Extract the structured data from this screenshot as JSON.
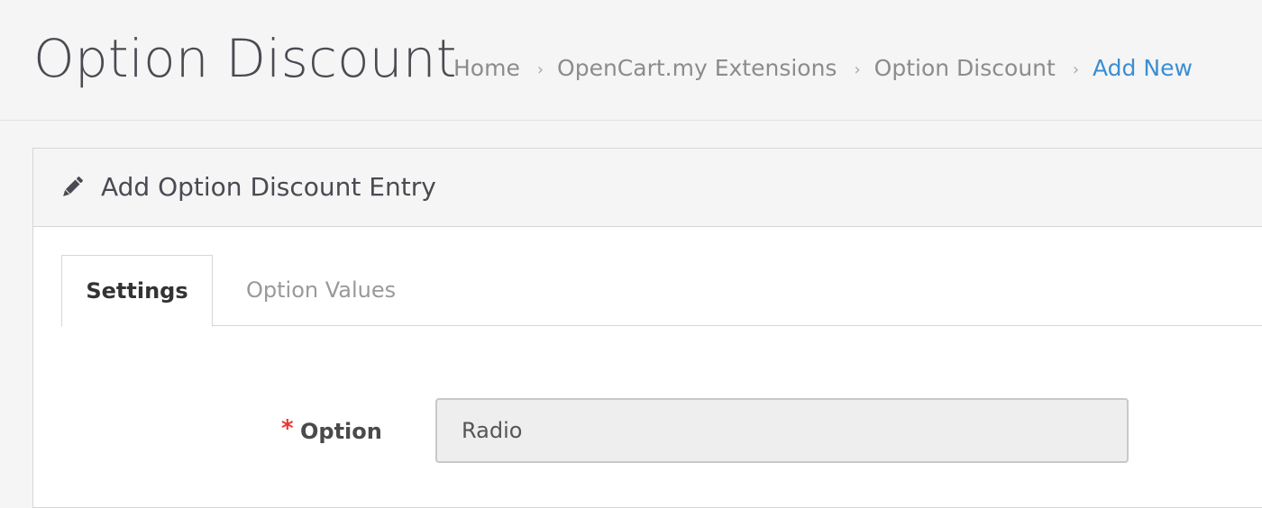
{
  "header": {
    "title": "Option Discount",
    "breadcrumbs": [
      {
        "label": "Home"
      },
      {
        "label": "OpenCart.my Extensions"
      },
      {
        "label": "Option Discount"
      },
      {
        "label": "Add New",
        "active": true
      }
    ],
    "separator": "›"
  },
  "panel": {
    "icon": "pencil-icon",
    "title": "Add Option Discount Entry"
  },
  "tabs": [
    {
      "label": "Settings",
      "active": true
    },
    {
      "label": "Option Values",
      "active": false
    }
  ],
  "form": {
    "option": {
      "required_mark": "*",
      "label": "Option",
      "value": "Radio"
    }
  },
  "colors": {
    "accent_link": "#3a8ed4",
    "required": "#e53935",
    "background": "#f5f5f5"
  }
}
